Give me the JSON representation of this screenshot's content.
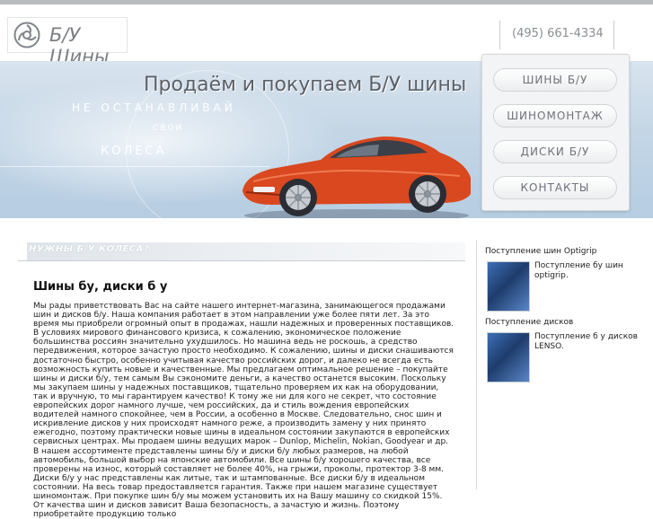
{
  "header": {
    "logo_text": "Б/У Шины",
    "phone": "(495) 661-4334"
  },
  "banner": {
    "title": "Продаём и покупаем Б/У шины",
    "slogan_line1": "НЕ ОСТАНАВЛИВАЙ",
    "slogan_line2": "СВОИ",
    "slogan_line3": "КОЛЕСА"
  },
  "menu": {
    "items": [
      {
        "label": "ШИНЫ Б/У"
      },
      {
        "label": "ШИНОМОНТАЖ"
      },
      {
        "label": "ДИСКИ Б/У"
      },
      {
        "label": "КОНТАКТЫ"
      }
    ]
  },
  "section": {
    "heading": "НУЖНЫ Б/У КОЛЕСА?"
  },
  "article": {
    "title": "Шины бу, диски б у",
    "body": "Мы рады приветствовать Вас на сайте нашего интернет-магазина, занимающегося продажами шин и дисков б/у. Наша компания работает в этом направлении уже более пяти лет. За это время мы приобрели огромный опыт в продажах, нашли надежных и проверенных поставщиков. В условиях мирового финансового кризиса, к сожалению, экономическое положение большинства россиян значительно ухудшилось. Но машина ведь не роскошь, а средство передвижения, которое зачастую просто необходимо. К сожалению, шины и диски снашиваются достаточно быстро, особенно учитывая качество российских дорог, и далеко не всегда есть возможность купить новые и качественные. Мы предлагаем оптимальное решение – покупайте шины и диски б/у, тем самым Вы сэкономите деньги, а качество останется высоким. Поскольку мы закупаем шины у надежных поставщиков, тщательно проверяем их как на оборудовании, так и вручную, то мы гарантируем качество! К тому же ни для кого не секрет, что состояние европейских дорог намного лучше, чем российских, да и стиль вождения европейских водителей намного спокойнее, чем в России, а особенно в Москве. Следовательно, снос шин и искривление дисков у них происходят намного реже, а производить замену у них принято ежегодно, поэтому практически новые шины в идеальном состоянии закупаются в европейских сервисных центрах. Мы продаем шины ведущих марок – Dunlop, Michelin, Nokian, Goodyear и др. В нашем ассортименте представлены шины б/у и диски б/у любых размеров, на любой автомобиль, большой выбор на японские автомобили. Все шины б/у хорошего качества, все проверены на износ, который составляет не более 40%, на грыжи, проколы, протектор 3-8 мм. Диски б/у у нас представлены как литые, так и штампованные. Все диски б/у в идеальном состоянии. На весь товар предоставляется гарантия. Также при нашем магазине существует шиномонтаж. При покупке шин б/у мы можем установить их на Вашу машину со скидкой 15%. От качества шин и дисков зависит Ваша безопасность, а зачастую и жизнь. Поэтому приобретайте продукцию только"
  },
  "sidebar": {
    "news": [
      {
        "title": "Поступление шин Optigrip",
        "text": "Поступление бу шин optigrip."
      },
      {
        "title": "Поступление дисков",
        "text": "Поступление б у дисков LENSO."
      }
    ]
  },
  "colors": {
    "banner_top": "#d9e4ee",
    "banner_bottom": "#b6cde2",
    "car_body": "#d9481f",
    "menu_text": "#6f737a"
  }
}
